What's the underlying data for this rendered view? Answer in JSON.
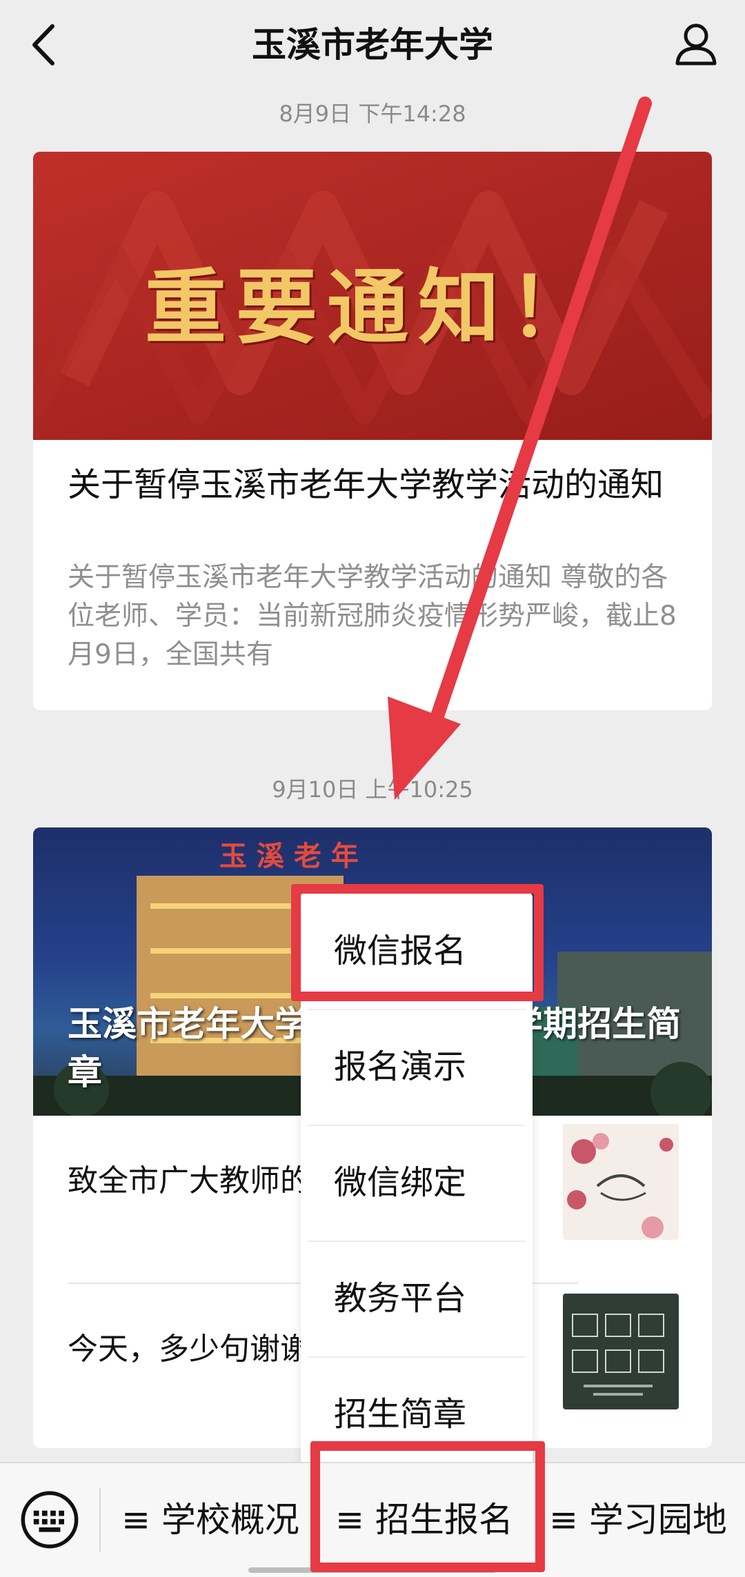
{
  "header": {
    "title": "玉溪市老年大学",
    "back_icon": "chevron-left-icon",
    "profile_icon": "user-icon"
  },
  "messages": [
    {
      "timestamp": "8月9日 下午14:28",
      "banner_text": "重要通知！",
      "title": "关于暂停玉溪市老年大学教学活动的通知",
      "description": "关于暂停玉溪市老年大学教学活动的通知 尊敬的各位老师、学员：当前新冠肺炎疫情形势严峻，截止8月9日，全国共有"
    },
    {
      "timestamp": "9月10日 上午10:25",
      "banner_title": "玉溪市老年大学2021年秋季学期招生简章",
      "items": [
        {
          "text": "致全市广大教师的一封信"
        },
        {
          "text": "今天，多少句谢谢都不为过"
        }
      ]
    }
  ],
  "popup_menu": {
    "items": [
      "微信报名",
      "报名演示",
      "微信绑定",
      "教务平台",
      "招生简章"
    ]
  },
  "bottom_menu": {
    "keyboard_icon": "keyboard-icon",
    "items": [
      "学校概况",
      "招生报名",
      "学习园地"
    ],
    "menu_glyph": "≡"
  },
  "annotation": {
    "arrow_color": "#e63a45",
    "highlight_color": "#e63a45"
  }
}
